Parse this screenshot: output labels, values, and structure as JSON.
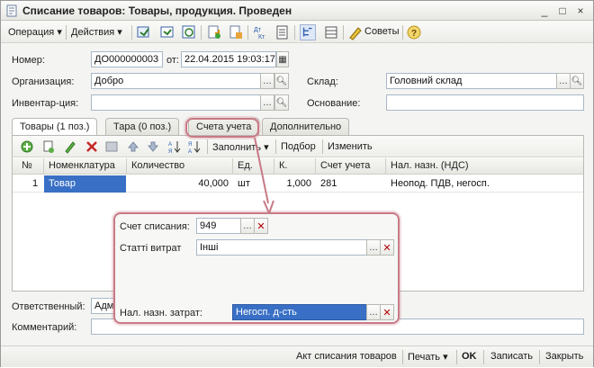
{
  "window": {
    "title": "Списание товаров: Товары, продукция. Проведен",
    "controls": [
      "_",
      "□",
      "×"
    ]
  },
  "toolbar": {
    "operation_label": "Операция",
    "actions_label": "Действия",
    "advice_label": "Советы",
    "dt_kt_label": "Дт Кт"
  },
  "form": {
    "number_label": "Номер:",
    "number_value": "ДО000000003",
    "from_label": "от:",
    "date_value": "22.04.2015 19:03:17",
    "org_label": "Организация:",
    "org_value": "Добро",
    "warehouse_label": "Склад:",
    "warehouse_value": "Головний склад",
    "inventory_label": "Инвентар-ция:",
    "inventory_value": "",
    "basis_label": "Основание:",
    "basis_value": ""
  },
  "tabs": [
    {
      "label": "Товары (1 поз.)"
    },
    {
      "label": "Тара (0 поз.)"
    },
    {
      "label": "Счета учета"
    },
    {
      "label": "Дополнительно"
    }
  ],
  "subtoolbar": {
    "fill_label": "Заполнить",
    "select_label": "Подбор",
    "change_label": "Изменить"
  },
  "table": {
    "columns": [
      "№",
      "Номенклатура",
      "Количество",
      "Ед.",
      "К.",
      "Счет учета",
      "Нал. назн. (НДС)"
    ],
    "rows": [
      {
        "n": "1",
        "item": "Товар",
        "qty": "40,000",
        "unit": "шт",
        "k": "1,000",
        "account": "281",
        "vat": "Неопод. ПДВ, негосп."
      }
    ]
  },
  "popup": {
    "writeoff_label": "Счет списания:",
    "writeoff_value": "949",
    "expense_label": "Статті витрат",
    "expense_value": "Інші",
    "tax_label": "Нал. назн. затрат:",
    "tax_value": "Негосп. д-сть"
  },
  "bottom": {
    "responsible_label": "Ответственный:",
    "responsible_value": "Адм",
    "comment_label": "Комментарий:",
    "comment_value": ""
  },
  "footer": {
    "act_label": "Акт списания товаров",
    "print_label": "Печать",
    "ok_label": "OK",
    "save_label": "Записать",
    "close_label": "Закрыть"
  },
  "colors": {
    "highlight": "#c87a86",
    "selection": "#3970c6"
  }
}
